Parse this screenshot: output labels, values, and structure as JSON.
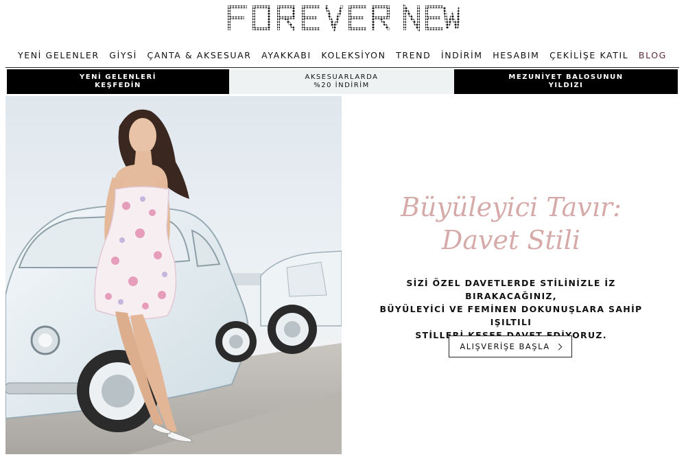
{
  "brand": {
    "logo_text": "FOREVER NEW"
  },
  "nav": {
    "items": [
      {
        "label": "YENİ GELENLER"
      },
      {
        "label": "GİYSİ"
      },
      {
        "label": "ÇANTA & AKSESUAR"
      },
      {
        "label": "AYAKKABI"
      },
      {
        "label": "KOLEKSİYON"
      },
      {
        "label": "TREND"
      },
      {
        "label": "İNDİRİM"
      },
      {
        "label": "HESABIM"
      },
      {
        "label": "ÇEKİLİŞE KATIL"
      },
      {
        "label": "BLOG"
      }
    ]
  },
  "promos": [
    {
      "line1": "YENİ GELENLERİ",
      "line2": "KEŞFEDİN"
    },
    {
      "line1": "AKSESUARLARDA",
      "line2": "%20 İNDİRİM"
    },
    {
      "line1": "MEZUNİYET BALOSUNUN",
      "line2": "YILDIZI"
    }
  ],
  "hero": {
    "headline_line1": "Büyüleyici Tavır:",
    "headline_line2": "Davet Stili",
    "body_line1": "SİZİ ÖZEL DAVETLERDE STİLİNİZLE İZ BIRAKACAĞINIZ,",
    "body_line2": "BÜYÜLEYİCİ VE FEMİNEN DOKUNUŞLARA SAHİP IŞILTILI",
    "body_line3": "STİLLERİ KEŞFE DAVET EDİYORUZ.",
    "cta_label": "ALIŞVERİŞE BAŞLA"
  },
  "colors": {
    "headline": "#d6aaa8",
    "blog": "#5b2a36",
    "promo_dark": "#000000",
    "promo_light": "#eef2f3"
  }
}
